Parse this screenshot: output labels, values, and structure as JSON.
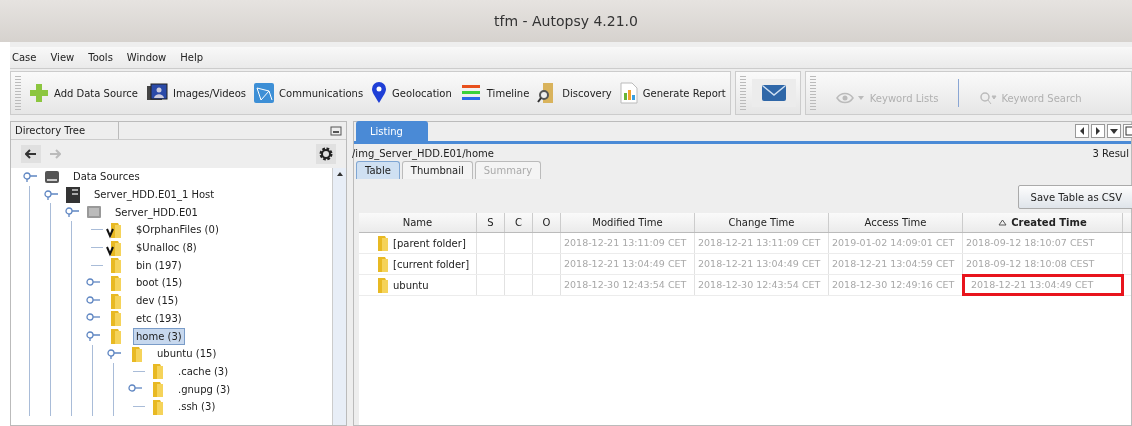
{
  "window": {
    "title": "tfm - Autopsy 4.21.0"
  },
  "menu": [
    "Case",
    "View",
    "Tools",
    "Window",
    "Help"
  ],
  "toolbar": [
    {
      "label": "Add Data Source",
      "kind": "add"
    },
    {
      "label": "Images/Videos",
      "kind": "images"
    },
    {
      "label": "Communications",
      "kind": "communications"
    },
    {
      "label": "Geolocation",
      "kind": "geolocation"
    },
    {
      "label": "Timeline",
      "kind": "timeline"
    },
    {
      "label": "Discovery",
      "kind": "discovery"
    },
    {
      "label": "Generate Report",
      "kind": "report"
    }
  ],
  "keyword_tools": [
    {
      "label": "Keyword Lists",
      "kind": "lists",
      "disabled": true
    },
    {
      "label": "Keyword Search",
      "kind": "search",
      "disabled": true
    }
  ],
  "directory_tree": {
    "title": "Directory Tree",
    "nodes": [
      {
        "label": "Data Sources",
        "kind": "drive",
        "expanded": true,
        "selected": false,
        "children": [
          {
            "label": "Server_HDD.E01_1 Host",
            "kind": "host",
            "expanded": true,
            "selected": false,
            "children": [
              {
                "label": "Server_HDD.E01",
                "kind": "disk",
                "expanded": true,
                "selected": false,
                "children": [
                  {
                    "label": "$OrphanFiles (0)",
                    "kind": "virtual",
                    "selected": false
                  },
                  {
                    "label": "$Unalloc (8)",
                    "kind": "virtual",
                    "selected": false
                  },
                  {
                    "label": "bin (197)",
                    "kind": "folder",
                    "selected": false
                  },
                  {
                    "label": "boot (15)",
                    "kind": "folder",
                    "expanded": false,
                    "selected": false
                  },
                  {
                    "label": "dev (15)",
                    "kind": "folder",
                    "expanded": false,
                    "selected": false
                  },
                  {
                    "label": "etc (193)",
                    "kind": "folder",
                    "expanded": false,
                    "selected": false
                  },
                  {
                    "label": "home (3)",
                    "kind": "folder",
                    "expanded": true,
                    "selected": true,
                    "children": [
                      {
                        "label": "ubuntu (15)",
                        "kind": "folder",
                        "expanded": true,
                        "selected": false,
                        "children": [
                          {
                            "label": ".cache (3)",
                            "kind": "folder",
                            "selected": false
                          },
                          {
                            "label": ".gnupg (3)",
                            "kind": "folder",
                            "expanded": false,
                            "selected": false
                          },
                          {
                            "label": ".ssh (3)",
                            "kind": "folder",
                            "selected": false
                          }
                        ]
                      }
                    ]
                  }
                ]
              }
            ]
          }
        ]
      }
    ]
  },
  "listing": {
    "tabs": [
      {
        "label": "Listing",
        "selected": true
      }
    ],
    "path": "/img_Server_HDD.E01/home",
    "results": "3 Resul",
    "view_tabs": [
      {
        "label": "Table",
        "selected": true,
        "disabled": false
      },
      {
        "label": "Thumbnail",
        "selected": false,
        "disabled": false
      },
      {
        "label": "Summary",
        "selected": false,
        "disabled": true
      }
    ],
    "save_button": "Save Table as CSV",
    "columns": [
      {
        "label": "Name",
        "sorted": false
      },
      {
        "label": "S",
        "sorted": false
      },
      {
        "label": "C",
        "sorted": false
      },
      {
        "label": "O",
        "sorted": false
      },
      {
        "label": "Modified Time",
        "sorted": false
      },
      {
        "label": "Change Time",
        "sorted": false
      },
      {
        "label": "Access Time",
        "sorted": false
      },
      {
        "label": "Created Time",
        "sorted": true
      }
    ],
    "rows": [
      {
        "name": "[parent folder]",
        "modified": "2018-12-21 13:11:09 CET",
        "changed": "2018-12-21 13:11:09 CET",
        "accessed": "2019-01-02 14:09:01 CET",
        "created": "2018-09-12 18:10:07 CEST",
        "created_marked": false
      },
      {
        "name": "[current folder]",
        "modified": "2018-12-21 13:04:49 CET",
        "changed": "2018-12-21 13:04:49 CET",
        "accessed": "2018-12-21 13:04:59 CET",
        "created": "2018-09-12 18:10:08 CEST",
        "created_marked": false
      },
      {
        "name": "ubuntu",
        "modified": "2018-12-30 12:43:54 CET",
        "changed": "2018-12-30 12:43:54 CET",
        "accessed": "2018-12-30 12:49:16 CET",
        "created": "2018-12-21 13:04:49 CET",
        "created_marked": true
      }
    ]
  }
}
